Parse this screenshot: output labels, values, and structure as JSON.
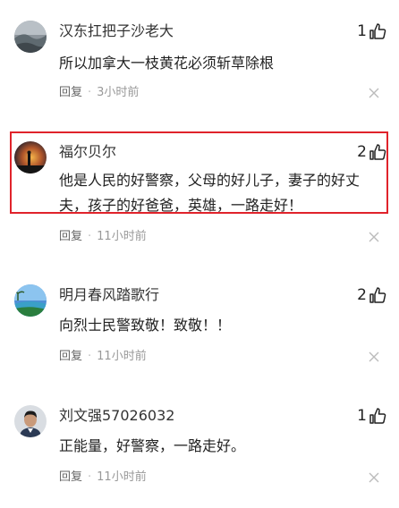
{
  "comments": [
    {
      "username": "汉东扛把子沙老大",
      "likes": "1",
      "content": "所以加拿大一枝黄花必须斩草除根",
      "reply_label": "回复",
      "time": "3小时前"
    },
    {
      "username": "福尔贝尔",
      "likes": "2",
      "content": "他是人民的好警察，父母的好儿子，妻子的好丈夫，孩子的好爸爸，英雄，一路走好！",
      "reply_label": "回复",
      "time": "11小时前",
      "highlighted": true,
      "highlight_color": "#e0232b"
    },
    {
      "username": "明月春风踏歌行",
      "likes": "2",
      "content": "向烈士民警致敬！致敬！！",
      "reply_label": "回复",
      "time": "11小时前"
    },
    {
      "username": "刘文强57026032",
      "likes": "1",
      "content": "正能量，好警察，一路走好。",
      "reply_label": "回复",
      "time": "11小时前"
    }
  ],
  "icons": {
    "like": "thumbs-up-icon",
    "close": "close-icon"
  }
}
